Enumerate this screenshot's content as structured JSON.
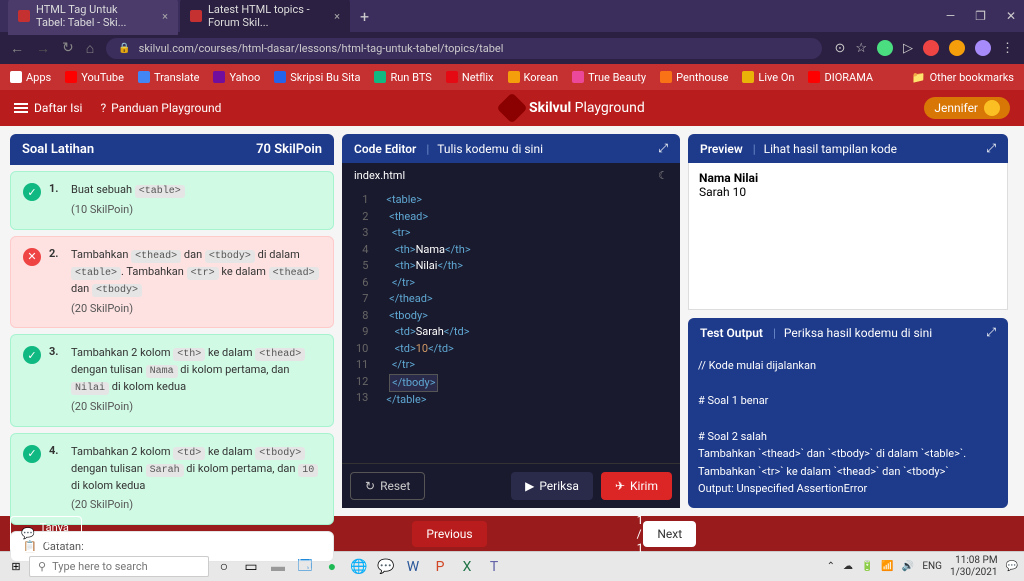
{
  "browser": {
    "tabs": [
      {
        "title": "HTML Tag Untuk Tabel: Tabel - Ski..."
      },
      {
        "title": "Latest HTML topics - Forum Skil..."
      }
    ],
    "url": "skilvul.com/courses/html-dasar/lessons/html-tag-untuk-tabel/topics/tabel",
    "bookmarks": [
      "Apps",
      "YouTube",
      "Translate",
      "Yahoo",
      "Skripsi Bu Sita",
      "Run BTS",
      "Netflix",
      "Korean",
      "True Beauty",
      "Penthouse",
      "Live On",
      "DIORAMA"
    ],
    "bookmarks_right": "Other bookmarks"
  },
  "header": {
    "daftar_isi": "Daftar Isi",
    "panduan": "Panduan Playground",
    "brand1": "Skilvul",
    "brand2": " Playground",
    "user": "Jennifer"
  },
  "soal": {
    "title": "Soal Latihan",
    "points": "70 SkilPoin",
    "tasks": [
      {
        "num": "1.",
        "text_pre": "Buat sebuah ",
        "code": "<table>",
        "points": "(10 SkilPoin)",
        "status": "ok"
      },
      {
        "num": "2.",
        "parts": [
          "Tambahkan ",
          "<thead>",
          " dan ",
          "<tbody>",
          " di dalam ",
          "<table>",
          ". Tambahkan ",
          "<tr>",
          " ke dalam ",
          "<thead>",
          " dan ",
          "<tbody>"
        ],
        "points": "(20 SkilPoin)",
        "status": "fail"
      },
      {
        "num": "3.",
        "parts": [
          "Tambahkan 2 kolom ",
          "<th>",
          " ke dalam ",
          "<thead>",
          " dengan tulisan ",
          "Nama",
          " di kolom pertama, dan ",
          "Nilai",
          " di kolom kedua"
        ],
        "points": "(20 SkilPoin)",
        "status": "ok"
      },
      {
        "num": "4.",
        "parts": [
          "Tambahkan 2 kolom ",
          "<td>",
          " ke dalam ",
          "<tbody>",
          " dengan tulisan ",
          "Sarah",
          " di kolom pertama, dan ",
          "10",
          " di kolom kedua"
        ],
        "points": "(20 SkilPoin)",
        "status": "ok"
      }
    ],
    "catatan": "Catatan:"
  },
  "editor": {
    "title": "Code Editor",
    "subtitle": "Tulis kodemu di sini",
    "file": "index.html",
    "lines": [
      "1",
      "2",
      "3",
      "4",
      "5",
      "6",
      "7",
      "8",
      "9",
      "10",
      "11",
      "12",
      "13"
    ],
    "reset": "Reset",
    "periksa": "Periksa",
    "kirim": "Kirim"
  },
  "preview": {
    "title": "Preview",
    "subtitle": "Lihat hasil tampilan kode",
    "th1": "Nama",
    "th2": "Nilai",
    "td1": "Sarah",
    "td2": "10"
  },
  "output": {
    "title": "Test Output",
    "subtitle": "Periksa hasil kodemu di sini",
    "l1": "// Kode mulai dijalankan",
    "l2": "# Soal 1 benar",
    "l3": "# Soal 2 salah",
    "l4": "Tambahkan `<thead>` dan `<tbody>` di dalam `<table>`. Tambahkan `<tr>` ke dalam `<thead>` dan `<tbody>`",
    "l5": "Output: Unspecified AssertionError"
  },
  "footer": {
    "forum": "Tanya Forum",
    "prev": "Previous",
    "page": "1 / 1",
    "next": "Next"
  },
  "taskbar": {
    "search": "Type here to search",
    "lang": "ENG",
    "time": "11:08 PM",
    "date": "1/30/2021"
  }
}
